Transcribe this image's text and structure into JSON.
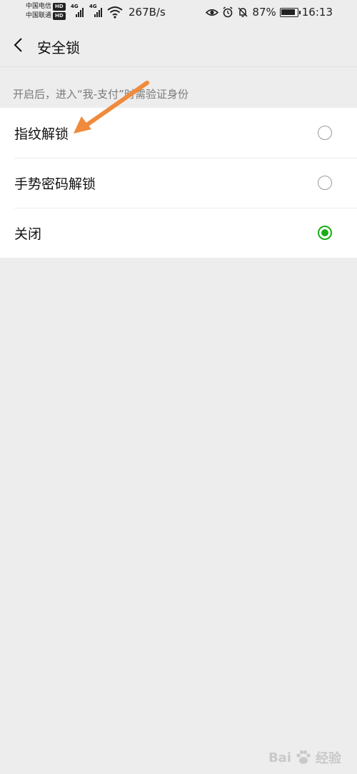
{
  "status_bar": {
    "carrier_1": "中国电信",
    "carrier_2": "中国联通",
    "hd_badge": "HD",
    "network_gen": "4G",
    "net_speed": "267B/s",
    "battery": "87%",
    "battery_level": 0.87,
    "time": "16:13"
  },
  "navbar": {
    "title": "安全锁"
  },
  "hint": "开启后，进入“我-支付”时需验证身份",
  "options": [
    {
      "label": "指纹解锁",
      "checked": false
    },
    {
      "label": "手势密码解锁",
      "checked": false
    },
    {
      "label": "关闭",
      "checked": true
    }
  ],
  "colors": {
    "accent": "#1aad19",
    "annotation_arrow": "#f08a3c",
    "background": "#ededed"
  },
  "watermark": {
    "brand": "Bai",
    "suffix": "经验"
  }
}
